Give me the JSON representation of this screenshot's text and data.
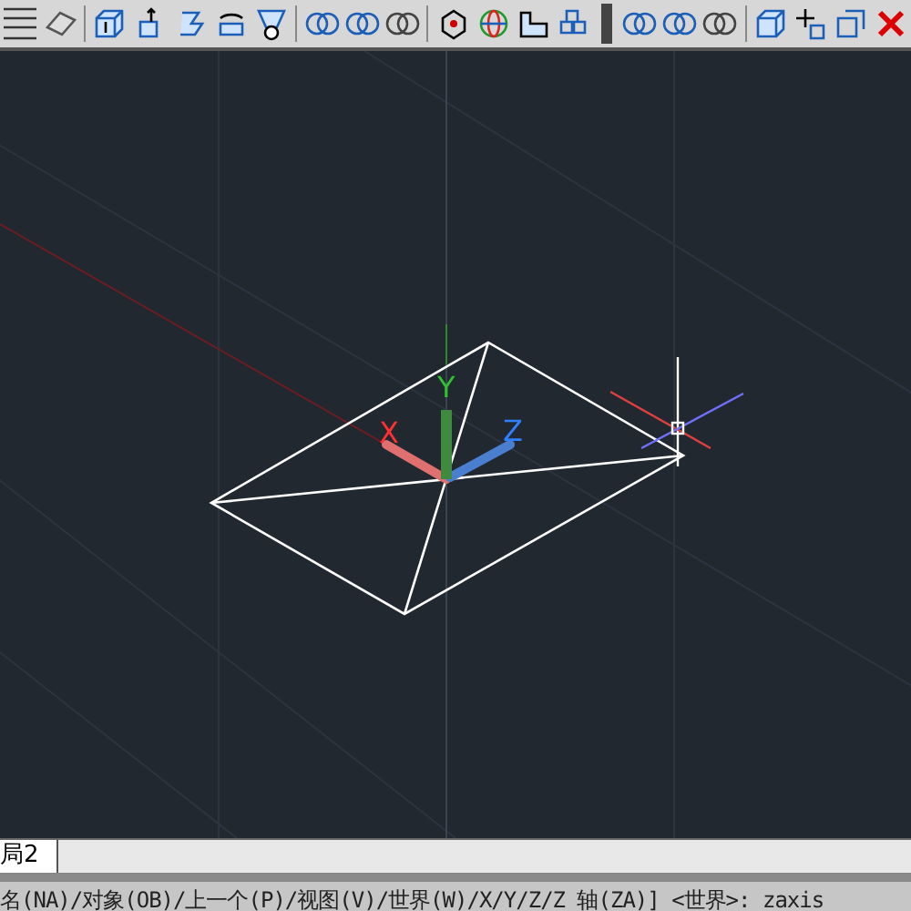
{
  "viewport": {
    "ucs_axes": [
      {
        "label": "X",
        "color": "#ff3030"
      },
      {
        "label": "Y",
        "color": "#30c030"
      },
      {
        "label": "Z",
        "color": "#2f7fff"
      }
    ]
  },
  "layout_tabs": [
    {
      "label": "局2",
      "selected": true
    }
  ],
  "command_line": {
    "text": "名(NA)/对象(OB)/上一个(P)/视图(V)/世界(W)/X/Y/Z/Z 轴(ZA)] <世界>:  zaxis"
  }
}
